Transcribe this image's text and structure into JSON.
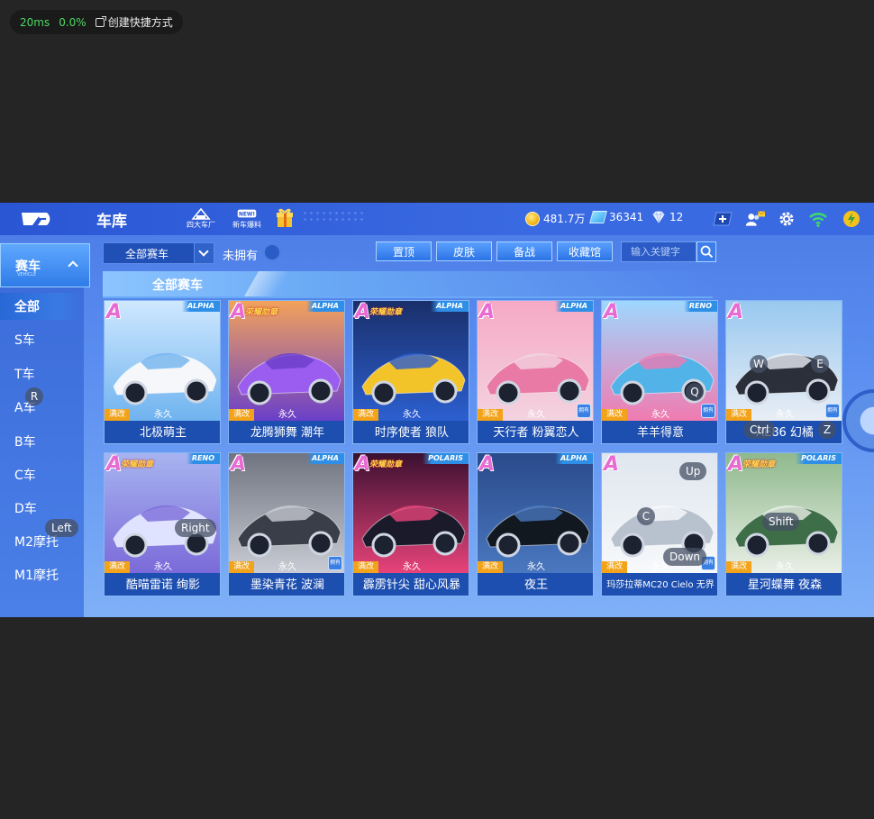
{
  "overlay": {
    "ping": "20ms",
    "loss": "0.0%",
    "shortcut_label": "创建快捷方式"
  },
  "header": {
    "title": "车库",
    "icons": [
      {
        "label": "四大车厂"
      },
      {
        "label": "新车爆料",
        "badge": "NEW!"
      }
    ],
    "currencies": {
      "coins": "481.7万",
      "coupons": "36341",
      "gems": "12"
    }
  },
  "sidebar": {
    "head": {
      "label": "赛车",
      "sub": "VEHICLE"
    },
    "items": [
      {
        "label": "全部",
        "active": true
      },
      {
        "label": "S车"
      },
      {
        "label": "T车"
      },
      {
        "label": "A车"
      },
      {
        "label": "B车"
      },
      {
        "label": "C车"
      },
      {
        "label": "D车"
      },
      {
        "label": "M2摩托"
      },
      {
        "label": "M1摩托"
      }
    ]
  },
  "toolbar": {
    "filter": "全部赛车",
    "owned_label": "未拥有",
    "buttons": [
      "置顶",
      "皮肤",
      "备战",
      "收藏馆"
    ],
    "search_placeholder": "输入关键字"
  },
  "section": {
    "title": "全部赛车"
  },
  "cards": [
    {
      "name": "北极萌主",
      "grade": "A",
      "brand": "ALPHA",
      "ribbon": "",
      "mods": "满改",
      "perm": "永久",
      "owned": "",
      "colors": [
        "#cfe8ff",
        "#6fb3ef",
        "#f5f7fa"
      ]
    },
    {
      "name": "龙腾狮舞 潮年",
      "grade": "A",
      "brand": "ALPHA",
      "ribbon": "荣耀勋章",
      "mods": "满改",
      "perm": "永久",
      "owned": "",
      "colors": [
        "#f3a25a",
        "#6a3fc9",
        "#9b5cf0"
      ]
    },
    {
      "name": "时序使者 狼队",
      "grade": "A",
      "brand": "ALPHA",
      "ribbon": "荣耀勋章",
      "mods": "满改",
      "perm": "永久",
      "owned": "",
      "colors": [
        "#1a2f6a",
        "#2c5fd0",
        "#f3c32a"
      ]
    },
    {
      "name": "天行者 粉翼恋人",
      "grade": "A",
      "brand": "ALPHA",
      "ribbon": "",
      "mods": "满改",
      "perm": "永久",
      "owned": "拥有",
      "colors": [
        "#f6a9c4",
        "#f3d3e0",
        "#e97aa6"
      ]
    },
    {
      "name": "羊羊得意",
      "grade": "A",
      "brand": "RENO",
      "ribbon": "",
      "mods": "满改",
      "perm": "永久",
      "owned": "拥有",
      "colors": [
        "#9ed7ff",
        "#f07bb0",
        "#52b3e8"
      ]
    },
    {
      "name": "AE86 幻橘",
      "grade": "A",
      "brand": "",
      "ribbon": "",
      "mods": "满改",
      "perm": "永久",
      "owned": "拥有",
      "colors": [
        "#98c8f0",
        "#e9eef5",
        "#2a2f3a"
      ]
    },
    {
      "name": "酷喵雷诺 绚影",
      "grade": "A",
      "brand": "RENO",
      "ribbon": "荣耀勋章",
      "mods": "满改",
      "perm": "永久",
      "owned": "",
      "colors": [
        "#a7b4f0",
        "#7b6ad9",
        "#dfe3ff"
      ]
    },
    {
      "name": "墨染青花 波澜",
      "grade": "A",
      "brand": "ALPHA",
      "ribbon": "",
      "mods": "满改",
      "perm": "永久",
      "owned": "拥有",
      "colors": [
        "#6f7480",
        "#c9ccd4",
        "#3a3e48"
      ]
    },
    {
      "name": "霹雳针尖 甜心风暴",
      "grade": "A",
      "brand": "POLARIS",
      "ribbon": "荣耀勋章",
      "mods": "满改",
      "perm": "永久",
      "owned": "",
      "colors": [
        "#3a1030",
        "#e8437a",
        "#1a1a2a"
      ]
    },
    {
      "name": "夜王",
      "grade": "A",
      "brand": "ALPHA",
      "ribbon": "",
      "mods": "满改",
      "perm": "永久",
      "owned": "",
      "colors": [
        "#2a4a8a",
        "#4a78c0",
        "#111820"
      ]
    },
    {
      "name": "玛莎拉蒂MC20 Cielo 无界",
      "grade": "A",
      "brand": "",
      "ribbon": "",
      "mods": "满改",
      "perm": "永久",
      "owned": "拥有",
      "colors": [
        "#dfe6ee",
        "#f7f9fb",
        "#b8c2cf"
      ]
    },
    {
      "name": "星河蝶舞 夜森",
      "grade": "A",
      "brand": "POLARIS",
      "ribbon": "荣耀勋章",
      "mods": "满改",
      "perm": "永久",
      "owned": "",
      "colors": [
        "#8fb98c",
        "#e9efe6",
        "#3e6e48"
      ]
    }
  ],
  "key_hints": [
    {
      "key": "R"
    },
    {
      "key": "Left"
    },
    {
      "key": "Right"
    },
    {
      "key": "W"
    },
    {
      "key": "E"
    },
    {
      "key": "Q"
    },
    {
      "key": "Ctrl"
    },
    {
      "key": "Z"
    },
    {
      "key": "Up"
    },
    {
      "key": "C"
    },
    {
      "key": "Down"
    },
    {
      "key": "Shift"
    }
  ],
  "colors": {
    "header": "#2a56d4",
    "panel": "#5b8ef0",
    "name_bar": "#1d4fb0",
    "grade": "#e86ad3"
  }
}
